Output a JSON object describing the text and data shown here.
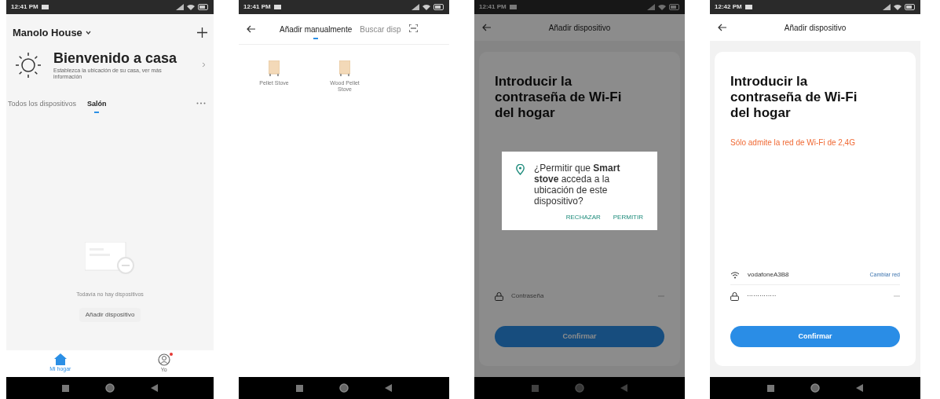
{
  "screens": [
    {
      "kind": "home",
      "time": "12:41 PM",
      "home_name": "Manolo House",
      "welcome_title": "Bienvenido a casa",
      "welcome_text": "Establezca la ubicación de su casa, ver más información",
      "tabs": [
        {
          "label": "Todos los dispositivos",
          "selected": false
        },
        {
          "label": "Salón",
          "selected": true
        }
      ],
      "empty_text": "Todavía no hay dispositivos",
      "add_button": "Añadir dispositivo",
      "nav": [
        {
          "label": "Mi hogar",
          "selected": true,
          "badge": false
        },
        {
          "label": "Yo",
          "selected": false,
          "badge": true
        }
      ]
    },
    {
      "kind": "add_manual",
      "time": "12:41 PM",
      "tabs": [
        {
          "label": "Añadir manualmente",
          "selected": true
        },
        {
          "label": "Buscar disp",
          "selected": false
        }
      ],
      "devices": [
        {
          "name": "Pellet Stove"
        },
        {
          "name": "Wood Pellet Stove"
        }
      ]
    },
    {
      "kind": "wifi",
      "time": "12:41 PM",
      "title": "Añadir dispositivo",
      "heading": "Introducir la contraseña de Wi-Fi del hogar",
      "password_placeholder": "Contraseña",
      "confirm_button": "Confirmar",
      "dialog": {
        "message": "¿Permitir que **Smart stove** acceda a la ubicación de este dispositivo?",
        "buttons": [
          "RECHAZAR",
          "PERMITIR"
        ]
      }
    },
    {
      "kind": "wifi",
      "time": "12:42 PM",
      "title": "Añadir dispositivo",
      "heading": "Introducir la contraseña de Wi-Fi del hogar",
      "notice": "Sólo admite la red de Wi-Fi de 2,4G",
      "network": "vodafoneA3B8",
      "change_network": "Cambiar red",
      "password_value": "··············",
      "confirm_button": "Confirmar"
    }
  ]
}
